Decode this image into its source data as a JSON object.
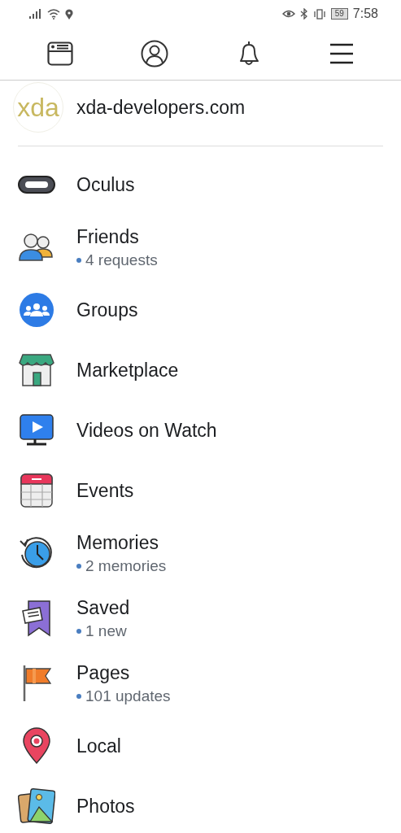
{
  "status_bar": {
    "battery": "59",
    "time": "7:58"
  },
  "profile": {
    "avatar_text": "xda",
    "name": "xda-developers.com"
  },
  "menu_items": [
    {
      "label": "Oculus"
    },
    {
      "label": "Friends",
      "detail": "4 requests"
    },
    {
      "label": "Groups"
    },
    {
      "label": "Marketplace"
    },
    {
      "label": "Videos on Watch"
    },
    {
      "label": "Events"
    },
    {
      "label": "Memories",
      "detail": "2 memories"
    },
    {
      "label": "Saved",
      "detail": "1 new"
    },
    {
      "label": "Pages",
      "detail": "101 updates"
    },
    {
      "label": "Local"
    },
    {
      "label": "Photos"
    }
  ]
}
